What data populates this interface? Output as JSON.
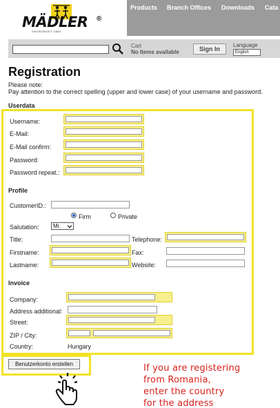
{
  "header": {
    "logo_text": "MÄDLER",
    "logo_reg": "®",
    "logo_sub": "GEGRÜNDET 1882",
    "nav": [
      "Products",
      "Branch Offices",
      "Downloads",
      "Cata"
    ]
  },
  "searchbar": {
    "search_value": "",
    "cart_label": "Cart",
    "cart_status": "No Items available",
    "signin_label": "Sign In",
    "language_label": "Language",
    "language_value": "English"
  },
  "page": {
    "title": "Registration",
    "note_label": "Please note:",
    "note_text": "Pay attention to the correct spelling (upper and lower case) of your username and password."
  },
  "userdata": {
    "heading": "Userdata",
    "username_label": "Username:",
    "email_label": "E-Mail:",
    "email_confirm_label": "E-Mail confirm:",
    "password_label": "Password:",
    "password_repeat_label": "Password repeat.:"
  },
  "profile": {
    "heading": "Profile",
    "customer_id_label": "CustomerID.:",
    "firm_label": "Firm",
    "private_label": "Private",
    "salutation_label": "Salutation:",
    "salutation_value": "Mr.",
    "title_label": "Title:",
    "telephone_label": "Telephone:",
    "firstname_label": "Firstname:",
    "fax_label": "Fax:",
    "lastname_label": "Lastname:",
    "website_label": "Website:"
  },
  "invoice": {
    "heading": "Invoice",
    "company_label": "Company:",
    "address_additional_label": "Address additional:",
    "street_label": "Street:",
    "zip_city_label": "ZIP / City:",
    "country_label": "Country:",
    "country_value": "Hungary"
  },
  "submit_label": "Benutzerkonto erstellen",
  "annotation": [
    "If you are registering",
    "from Romania,",
    "enter the country",
    "for the address"
  ],
  "colors": {
    "highlight": "#f2e324",
    "annotation": "#d9201c",
    "nav_bg": "#9b9b9b"
  }
}
